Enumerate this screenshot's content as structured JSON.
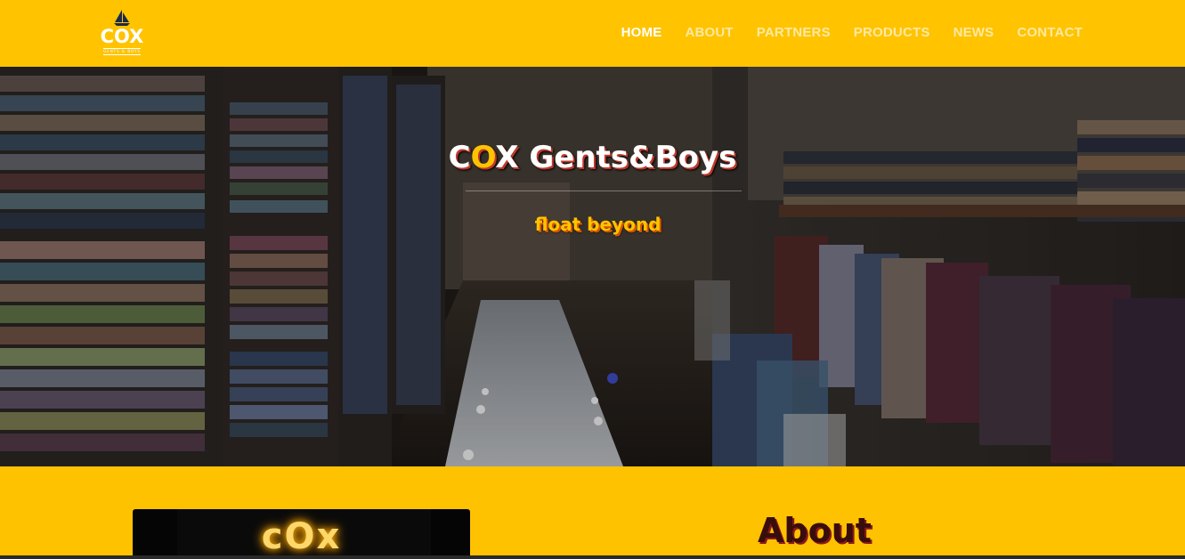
{
  "header": {
    "logo_text": "COX",
    "logo_subtext": "GENTS & BOYS",
    "nav": [
      {
        "label": "HOME",
        "active": true
      },
      {
        "label": "ABOUT",
        "active": false
      },
      {
        "label": "PARTNERS",
        "active": false
      },
      {
        "label": "PRODUCTS",
        "active": false
      },
      {
        "label": "NEWS",
        "active": false
      },
      {
        "label": "CONTACT",
        "active": false
      }
    ]
  },
  "hero": {
    "title_c": "C",
    "title_o": "O",
    "title_rest": "X Gents&Boys",
    "tagline": "float beyond"
  },
  "about": {
    "photo_sign": "cOx",
    "title": "About"
  },
  "colors": {
    "brand_yellow": "#ffc300",
    "dark_red_text": "#3a0d0d"
  }
}
